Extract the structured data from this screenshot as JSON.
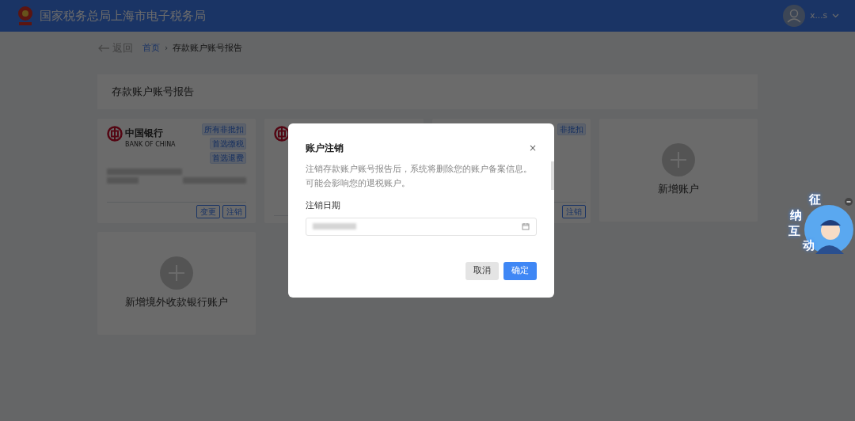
{
  "header": {
    "title": "国家税务总局上海市电子税务局",
    "user": "x...s"
  },
  "back": "返回",
  "breadcrumb_separator": "›",
  "breadcrumb": [
    {
      "label": "首页",
      "link": true
    },
    {
      "label": "存款账户账号报告",
      "link": false
    }
  ],
  "page_title": "存款账户账号报告",
  "accounts": [
    {
      "kind": "bank",
      "logo": true,
      "bank_name": "中国银行",
      "bank_name_en": "BANK OF CHINA",
      "tags": [
        "所有非批扣",
        "首选缴税",
        "首选退费"
      ],
      "buttons": [
        "变更",
        "注销"
      ]
    },
    {
      "kind": "bank",
      "logo": true
    },
    {
      "kind": "bank",
      "tags": [
        "非批扣"
      ],
      "buttons": [
        "注销"
      ]
    },
    {
      "kind": "add",
      "label": "新增账户"
    },
    {
      "kind": "add",
      "label": "新增境外收款银行账户"
    }
  ],
  "dialog": {
    "title": "账户注销",
    "close": "×",
    "message": "注销存款账户账号报告后，系统将删除您的账户备案信息。可能会影响您的退税账户。",
    "field_label": "注销日期",
    "buttons": [
      {
        "label": "取消",
        "primary": false
      },
      {
        "label": "确定",
        "primary": true
      }
    ]
  },
  "widget": {
    "chars": [
      "征",
      "纳",
      "互",
      "动"
    ]
  }
}
